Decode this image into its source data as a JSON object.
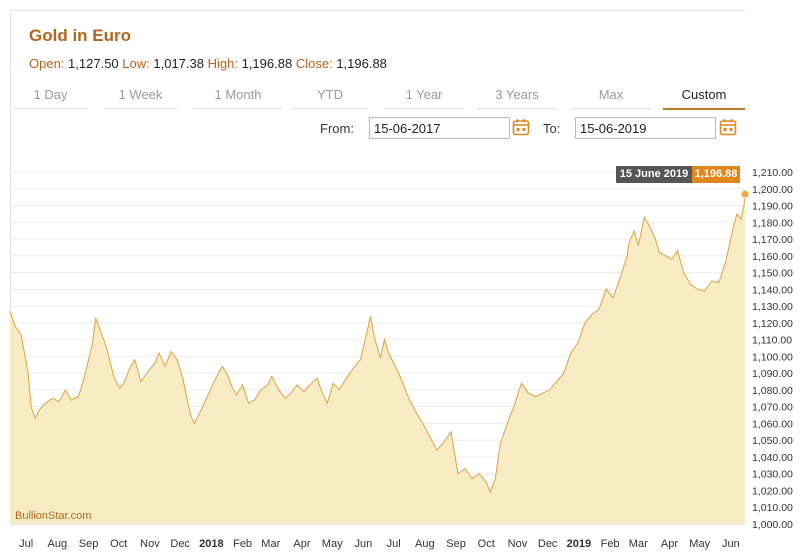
{
  "header": {
    "title": "Gold in Euro",
    "open_label": "Open:",
    "open": "1,127.50",
    "low_label": "Low:",
    "low": "1,017.38",
    "high_label": "High:",
    "high": "1,196.88",
    "close_label": "Close:",
    "close": "1,196.88"
  },
  "tabs": [
    "1 Day",
    "1 Week",
    "1 Month",
    "YTD",
    "1 Year",
    "3 Years",
    "Max",
    "Custom"
  ],
  "active_tab": "Custom",
  "range": {
    "from_label": "From:",
    "from_value": "15-06-2017",
    "to_label": "To:",
    "to_value": "15-06-2019"
  },
  "tooltip": {
    "date": "15 June 2019",
    "value": "1,196.88"
  },
  "watermark": "BullionStar.com",
  "colors": {
    "accent": "#b5651d",
    "line": "#e0a040",
    "fill": "#f8ecc5",
    "tooltip_value_bg": "#e0861b",
    "tooltip_date_bg": "#555555"
  },
  "chart_data": {
    "type": "area",
    "title": "Gold in Euro",
    "ylim": [
      1000,
      1210
    ],
    "yticks": [
      1000,
      1010,
      1020,
      1030,
      1040,
      1050,
      1060,
      1070,
      1080,
      1090,
      1100,
      1110,
      1120,
      1130,
      1140,
      1150,
      1160,
      1170,
      1180,
      1190,
      1200,
      1210
    ],
    "ytick_labels": [
      "1,000.00",
      "1,010.00",
      "1,020.00",
      "1,030.00",
      "1,040.00",
      "1,050.00",
      "1,060.00",
      "1,070.00",
      "1,080.00",
      "1,090.00",
      "1,100.00",
      "1,110.00",
      "1,120.00",
      "1,130.00",
      "1,140.00",
      "1,150.00",
      "1,160.00",
      "1,170.00",
      "1,180.00",
      "1,190.00",
      "1,200.00",
      "1,210.00"
    ],
    "xlim": [
      "2017-06-15",
      "2019-06-15"
    ],
    "xticks": [
      {
        "date": "2017-07-01",
        "label": "Jul"
      },
      {
        "date": "2017-08-01",
        "label": "Aug"
      },
      {
        "date": "2017-09-01",
        "label": "Sep"
      },
      {
        "date": "2017-10-01",
        "label": "Oct"
      },
      {
        "date": "2017-11-01",
        "label": "Nov"
      },
      {
        "date": "2017-12-01",
        "label": "Dec"
      },
      {
        "date": "2018-01-01",
        "label": "2018",
        "bold": true
      },
      {
        "date": "2018-02-01",
        "label": "Feb"
      },
      {
        "date": "2018-03-01",
        "label": "Mar"
      },
      {
        "date": "2018-04-01",
        "label": "Apr"
      },
      {
        "date": "2018-05-01",
        "label": "May"
      },
      {
        "date": "2018-06-01",
        "label": "Jun"
      },
      {
        "date": "2018-07-01",
        "label": "Jul"
      },
      {
        "date": "2018-08-01",
        "label": "Aug"
      },
      {
        "date": "2018-09-01",
        "label": "Sep"
      },
      {
        "date": "2018-10-01",
        "label": "Oct"
      },
      {
        "date": "2018-11-01",
        "label": "Nov"
      },
      {
        "date": "2018-12-01",
        "label": "Dec"
      },
      {
        "date": "2019-01-01",
        "label": "2019",
        "bold": true
      },
      {
        "date": "2019-02-01",
        "label": "Feb"
      },
      {
        "date": "2019-03-01",
        "label": "Mar"
      },
      {
        "date": "2019-04-01",
        "label": "Apr"
      },
      {
        "date": "2019-05-01",
        "label": "May"
      },
      {
        "date": "2019-06-01",
        "label": "Jun"
      }
    ],
    "grid": true,
    "series": [
      {
        "points": [
          [
            "2017-06-15",
            1127
          ],
          [
            "2017-06-20",
            1118
          ],
          [
            "2017-06-26",
            1113
          ],
          [
            "2017-07-03",
            1090
          ],
          [
            "2017-07-06",
            1070
          ],
          [
            "2017-07-10",
            1063
          ],
          [
            "2017-07-14",
            1068
          ],
          [
            "2017-07-20",
            1072
          ],
          [
            "2017-07-27",
            1075
          ],
          [
            "2017-08-03",
            1073
          ],
          [
            "2017-08-09",
            1080
          ],
          [
            "2017-08-15",
            1074
          ],
          [
            "2017-08-22",
            1076
          ],
          [
            "2017-08-28",
            1088
          ],
          [
            "2017-09-05",
            1108
          ],
          [
            "2017-09-08",
            1123
          ],
          [
            "2017-09-13",
            1115
          ],
          [
            "2017-09-19",
            1105
          ],
          [
            "2017-09-26",
            1088
          ],
          [
            "2017-10-02",
            1081
          ],
          [
            "2017-10-06",
            1084
          ],
          [
            "2017-10-12",
            1093
          ],
          [
            "2017-10-17",
            1098
          ],
          [
            "2017-10-23",
            1085
          ],
          [
            "2017-10-30",
            1091
          ],
          [
            "2017-11-06",
            1096
          ],
          [
            "2017-11-10",
            1102
          ],
          [
            "2017-11-16",
            1094
          ],
          [
            "2017-11-22",
            1103
          ],
          [
            "2017-11-28",
            1098
          ],
          [
            "2017-12-04",
            1086
          ],
          [
            "2017-12-08",
            1074
          ],
          [
            "2017-12-12",
            1064
          ],
          [
            "2017-12-15",
            1060
          ],
          [
            "2017-12-21",
            1067
          ],
          [
            "2017-12-28",
            1076
          ],
          [
            "2018-01-03",
            1084
          ],
          [
            "2018-01-08",
            1090
          ],
          [
            "2018-01-12",
            1094
          ],
          [
            "2018-01-17",
            1089
          ],
          [
            "2018-01-22",
            1081
          ],
          [
            "2018-01-26",
            1077
          ],
          [
            "2018-02-01",
            1083
          ],
          [
            "2018-02-07",
            1072
          ],
          [
            "2018-02-13",
            1074
          ],
          [
            "2018-02-19",
            1080
          ],
          [
            "2018-02-26",
            1083
          ],
          [
            "2018-03-02",
            1088
          ],
          [
            "2018-03-08",
            1081
          ],
          [
            "2018-03-15",
            1075
          ],
          [
            "2018-03-21",
            1078
          ],
          [
            "2018-03-27",
            1083
          ],
          [
            "2018-04-03",
            1079
          ],
          [
            "2018-04-09",
            1083
          ],
          [
            "2018-04-16",
            1087
          ],
          [
            "2018-04-20",
            1080
          ],
          [
            "2018-04-26",
            1072
          ],
          [
            "2018-05-02",
            1084
          ],
          [
            "2018-05-08",
            1080
          ],
          [
            "2018-05-14",
            1086
          ],
          [
            "2018-05-21",
            1092
          ],
          [
            "2018-05-29",
            1098
          ],
          [
            "2018-06-04",
            1113
          ],
          [
            "2018-06-08",
            1124
          ],
          [
            "2018-06-12",
            1111
          ],
          [
            "2018-06-18",
            1099
          ],
          [
            "2018-06-22",
            1110
          ],
          [
            "2018-06-26",
            1102
          ],
          [
            "2018-07-02",
            1095
          ],
          [
            "2018-07-09",
            1086
          ],
          [
            "2018-07-16",
            1075
          ],
          [
            "2018-07-23",
            1067
          ],
          [
            "2018-07-30",
            1060
          ],
          [
            "2018-08-06",
            1052
          ],
          [
            "2018-08-13",
            1044
          ],
          [
            "2018-08-20",
            1049
          ],
          [
            "2018-08-27",
            1055
          ],
          [
            "2018-09-03",
            1030
          ],
          [
            "2018-09-10",
            1033
          ],
          [
            "2018-09-17",
            1027
          ],
          [
            "2018-09-24",
            1030
          ],
          [
            "2018-10-01",
            1025
          ],
          [
            "2018-10-05",
            1019
          ],
          [
            "2018-10-10",
            1027
          ],
          [
            "2018-10-15",
            1048
          ],
          [
            "2018-10-22",
            1060
          ],
          [
            "2018-10-29",
            1071
          ],
          [
            "2018-11-05",
            1084
          ],
          [
            "2018-11-12",
            1078
          ],
          [
            "2018-11-19",
            1076
          ],
          [
            "2018-11-26",
            1078
          ],
          [
            "2018-12-03",
            1080
          ],
          [
            "2018-12-10",
            1085
          ],
          [
            "2018-12-17",
            1090
          ],
          [
            "2018-12-24",
            1102
          ],
          [
            "2018-12-31",
            1108
          ],
          [
            "2019-01-07",
            1120
          ],
          [
            "2019-01-14",
            1125
          ],
          [
            "2019-01-21",
            1128
          ],
          [
            "2019-01-28",
            1140
          ],
          [
            "2019-02-04",
            1135
          ],
          [
            "2019-02-11",
            1147
          ],
          [
            "2019-02-18",
            1160
          ],
          [
            "2019-02-20",
            1168
          ],
          [
            "2019-02-25",
            1175
          ],
          [
            "2019-03-01",
            1166
          ],
          [
            "2019-03-07",
            1183
          ],
          [
            "2019-03-12",
            1178
          ],
          [
            "2019-03-18",
            1170
          ],
          [
            "2019-03-22",
            1162
          ],
          [
            "2019-03-28",
            1160
          ],
          [
            "2019-04-03",
            1158
          ],
          [
            "2019-04-09",
            1163
          ],
          [
            "2019-04-15",
            1150
          ],
          [
            "2019-04-22",
            1143
          ],
          [
            "2019-04-29",
            1140
          ],
          [
            "2019-05-06",
            1139
          ],
          [
            "2019-05-13",
            1145
          ],
          [
            "2019-05-20",
            1144
          ],
          [
            "2019-05-27",
            1157
          ],
          [
            "2019-06-03",
            1176
          ],
          [
            "2019-06-07",
            1185
          ],
          [
            "2019-06-11",
            1182
          ],
          [
            "2019-06-14",
            1190
          ],
          [
            "2019-06-15",
            1196.88
          ]
        ]
      }
    ]
  }
}
